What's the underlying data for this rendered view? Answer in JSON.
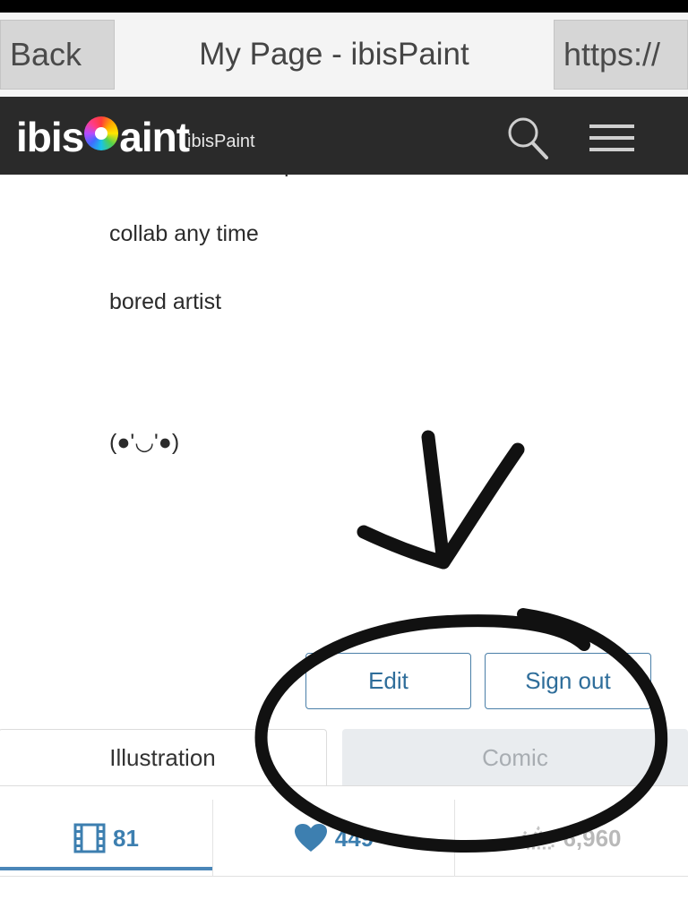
{
  "browser": {
    "back_label": "Back",
    "title": "My Page - ibisPaint",
    "url_label": "https://"
  },
  "site_header": {
    "logo_text_left": "ibis",
    "logo_text_right": "aint",
    "logo_sub": "ibisPaint",
    "search_icon": "search-icon",
    "menu_icon": "hamburger-menu-icon"
  },
  "bio": {
    "line_cut": "ipp",
    "line_collab": "collab any time",
    "line_bored": "bored artist",
    "line_face": "(●'◡'●)"
  },
  "actions": {
    "edit_label": "Edit",
    "signout_label": "Sign out"
  },
  "tabs": {
    "illustration_label": "Illustration",
    "comic_label": "Comic"
  },
  "stats": {
    "artworks_icon": "film-icon",
    "artworks_count": "81",
    "likes_icon": "heart-icon",
    "likes_count": "449",
    "views_icon": "crown-icon",
    "views_count": "6,960"
  },
  "colors": {
    "header_bg": "#2a2a2a",
    "accent_blue": "#3d7fb0",
    "comic_tab_bg": "#e9ecef"
  }
}
